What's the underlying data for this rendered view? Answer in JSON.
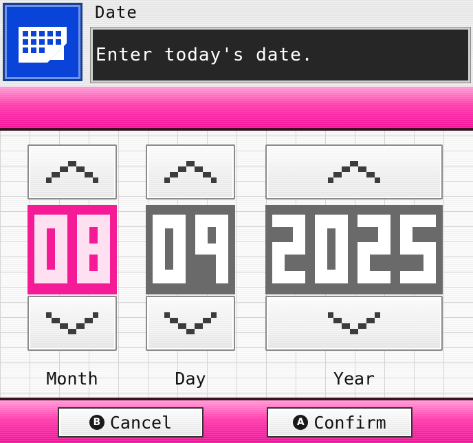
{
  "header": {
    "icon": "calendar-icon",
    "title": "Date",
    "message": "Enter today's date."
  },
  "fields": [
    {
      "key": "month",
      "label": "Month",
      "value": "08",
      "selected": true
    },
    {
      "key": "day",
      "label": "Day",
      "value": "09",
      "selected": false
    },
    {
      "key": "year",
      "label": "Year",
      "value": "2025",
      "selected": false
    }
  ],
  "footer": {
    "cancel": {
      "icon": "b-button-icon",
      "glyph": "B",
      "label": "Cancel"
    },
    "confirm": {
      "icon": "a-button-icon",
      "glyph": "A",
      "label": "Confirm"
    }
  },
  "colors": {
    "accent_pink": "#f51b97",
    "value_gray": "#6a6a6a",
    "icon_blue": "#0a43d8"
  }
}
